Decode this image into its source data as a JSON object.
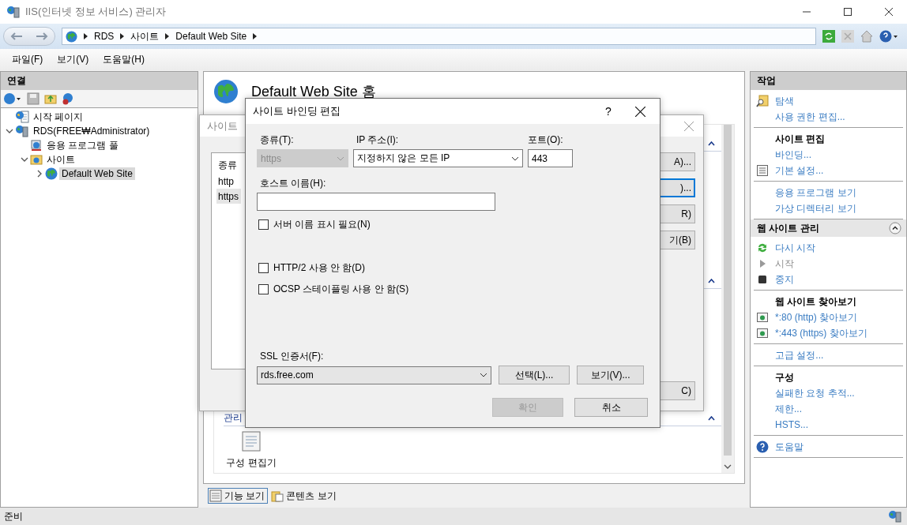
{
  "window": {
    "title": "IIS(인터넷 정보 서비스) 관리자"
  },
  "address_bar": {
    "path": [
      "RDS",
      "사이트",
      "Default Web Site"
    ]
  },
  "menu": [
    "파일(F)",
    "보기(V)",
    "도움말(H)"
  ],
  "connections": {
    "title": "연결",
    "tree": [
      {
        "label": "시작 페이지",
        "kind": "start",
        "selected": false
      },
      {
        "label": "RDS(FREE₩Administrator)",
        "kind": "server",
        "selected": false,
        "expanded": true,
        "children": [
          {
            "label": "응용 프로그램 풀",
            "kind": "pool",
            "selected": false
          },
          {
            "label": "사이트",
            "kind": "sites",
            "selected": false,
            "expanded": true,
            "children": [
              {
                "label": "Default Web Site",
                "kind": "site",
                "selected": true,
                "expanded": false
              }
            ]
          }
        ]
      }
    ]
  },
  "center": {
    "title": "Default Web Site 홈",
    "groups": [
      {
        "expanded": true
      },
      {
        "expanded": true
      },
      {
        "title": "관리",
        "expanded": true,
        "features": [
          {
            "label": "구성 편집기"
          }
        ]
      }
    ],
    "view_tabs": [
      {
        "label": "기능 보기",
        "selected": true
      },
      {
        "label": "콘텐츠 보기",
        "selected": false
      }
    ]
  },
  "bindings_dialog": {
    "title": "사이트",
    "columns": [
      "종류"
    ],
    "rows": [
      {
        "cells": [
          "http"
        ],
        "selected": false
      },
      {
        "cells": [
          "https"
        ],
        "selected": true
      }
    ],
    "buttons": [
      {
        "label": "A)...",
        "focused": false
      },
      {
        "label": ")...",
        "focused": true
      },
      {
        "label": "R)",
        "focused": false
      },
      {
        "label": "기(B)",
        "focused": false
      }
    ],
    "close_button": {
      "label": "C)",
      "focused": false
    }
  },
  "edit_dialog": {
    "title": "사이트 바인딩 편집",
    "help": "?",
    "type": {
      "label": "종류(T):",
      "value": "https",
      "disabled": true
    },
    "ip": {
      "label": "IP 주소(I):",
      "value": "지정하지 않은 모든 IP"
    },
    "port": {
      "label": "포트(O):",
      "value": "443"
    },
    "host": {
      "label": "호스트 이름(H):"
    },
    "checkboxes": [
      {
        "label": "서버 이름 표시 필요(N)",
        "checked": false
      },
      {
        "label": "HTTP/2 사용 안 함(D)",
        "checked": false
      },
      {
        "label": "OCSP 스테이플링 사용 안 함(S)",
        "checked": false
      }
    ],
    "ssl": {
      "label": "SSL 인증서(F):",
      "value": "rds.free.com",
      "buttons": [
        "선택(L)...",
        "보기(V)..."
      ]
    },
    "buttons": [
      {
        "label": "확인",
        "disabled": true
      },
      {
        "label": "취소",
        "disabled": false
      }
    ]
  },
  "actions": {
    "title": "작업",
    "sections": [
      {
        "groups": [
          [
            {
              "kind": "explore",
              "label": "탐색"
            },
            {
              "kind": "link",
              "label": "사용 권한 편집..."
            }
          ],
          [
            {
              "kind": "header",
              "label": "사이트 편집"
            },
            {
              "kind": "link",
              "label": "바인딩..."
            },
            {
              "kind": "settings",
              "label": "기본 설정..."
            }
          ],
          [
            {
              "kind": "link",
              "label": "응용 프로그램 보기"
            },
            {
              "kind": "link",
              "label": "가상 디렉터리 보기"
            }
          ]
        ]
      },
      {
        "title": "웹 사이트 관리",
        "expanded": true,
        "groups": [
          [
            {
              "kind": "restart",
              "label": "다시 시작",
              "disabled": false
            },
            {
              "kind": "start",
              "label": "시작",
              "disabled": true
            },
            {
              "kind": "stop",
              "label": "중지",
              "disabled": false
            }
          ],
          [
            {
              "kind": "header",
              "label": "웹 사이트 찾아보기"
            },
            {
              "kind": "browse",
              "label": "*:80 (http) 찾아보기"
            },
            {
              "kind": "browse",
              "label": "*:443 (https) 찾아보기"
            }
          ],
          [
            {
              "kind": "link",
              "label": "고급 설정..."
            }
          ],
          [
            {
              "kind": "header",
              "label": "구성"
            },
            {
              "kind": "link",
              "label": "실패한 요청 추적..."
            },
            {
              "kind": "link",
              "label": "제한..."
            },
            {
              "kind": "link",
              "label": "HSTS..."
            }
          ],
          [
            {
              "kind": "help",
              "label": "도움말"
            }
          ]
        ]
      }
    ]
  },
  "status_bar": {
    "text": "준비"
  }
}
